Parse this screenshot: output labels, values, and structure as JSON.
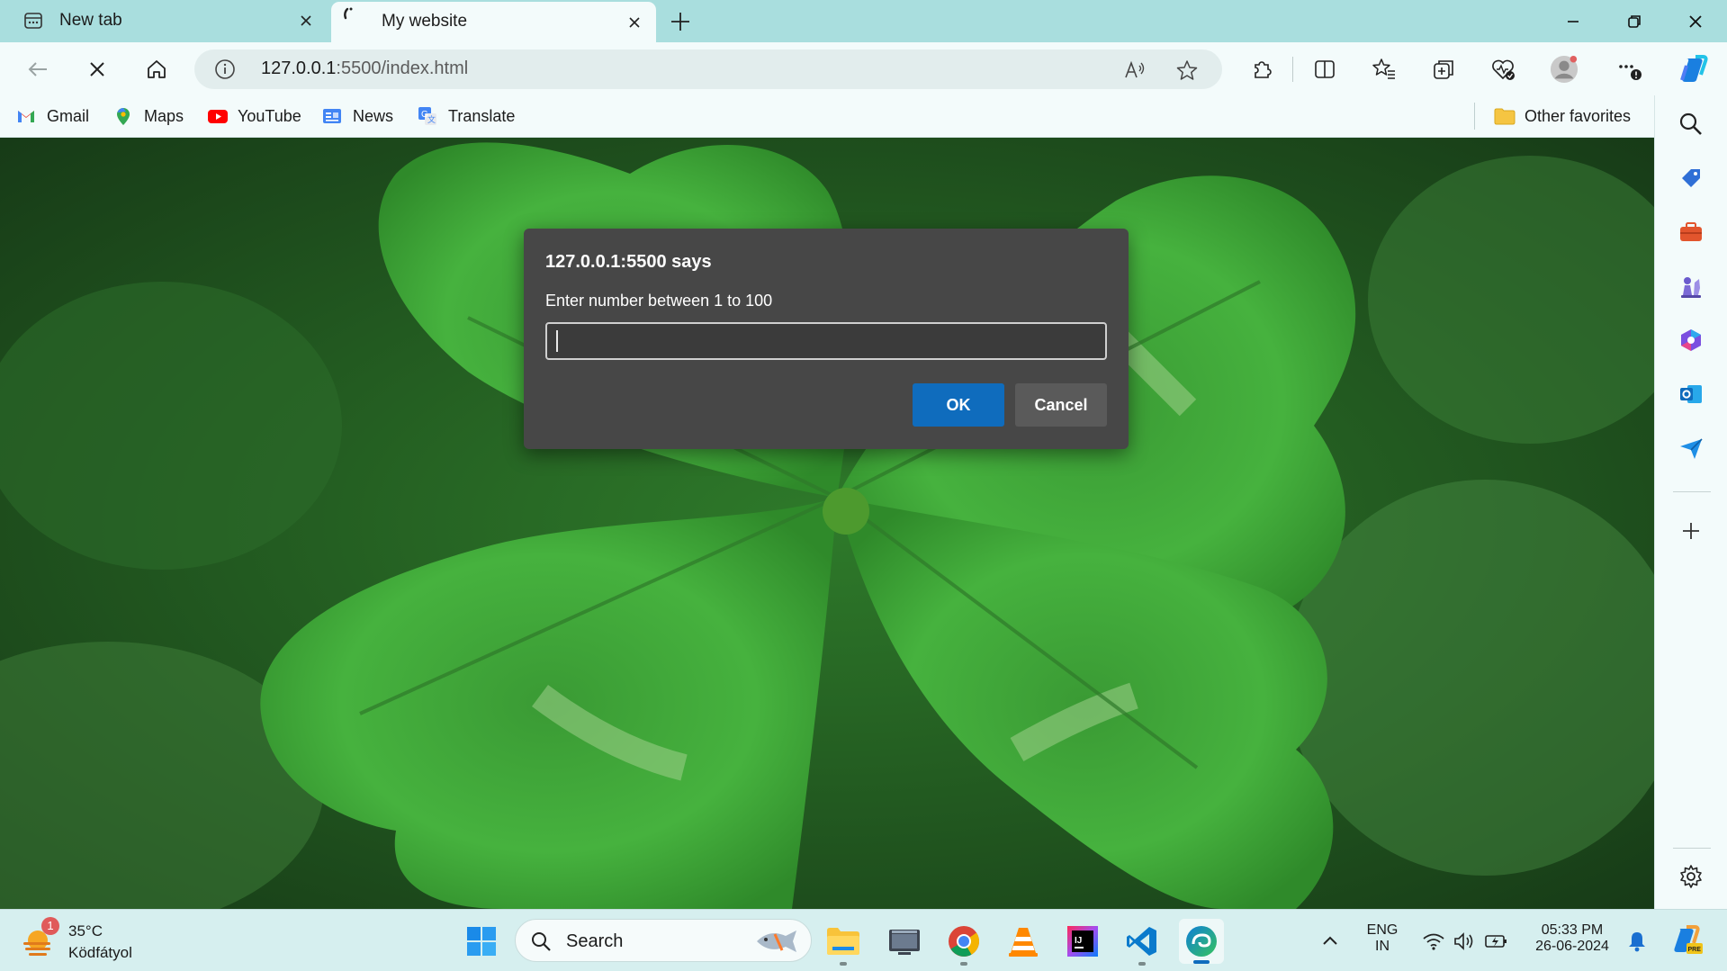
{
  "tabs": [
    {
      "title": "New tab",
      "icon": "new-tab-page-icon",
      "active": false
    },
    {
      "title": "My website",
      "icon": "loading-spinner-icon",
      "active": true
    }
  ],
  "toolbar": {
    "url_host": "127.0.0.1",
    "url_path": ":5500/index.html"
  },
  "favorites": [
    {
      "label": "Gmail",
      "icon": "gmail-icon"
    },
    {
      "label": "Maps",
      "icon": "maps-icon"
    },
    {
      "label": "YouTube",
      "icon": "youtube-icon"
    },
    {
      "label": "News",
      "icon": "news-icon"
    },
    {
      "label": "Translate",
      "icon": "translate-icon"
    }
  ],
  "other_favorites": "Other favorites",
  "dialog": {
    "title": "127.0.0.1:5500 says",
    "message": "Enter number between 1 to 100",
    "input_value": "",
    "ok_label": "OK",
    "cancel_label": "Cancel"
  },
  "taskbar": {
    "weather_badge": "1",
    "temperature": "35°C",
    "condition": "Ködfátyol",
    "search_label": "Search",
    "lang_top": "ENG",
    "lang_bottom": "IN",
    "time": "05:33 PM",
    "date": "26-06-2024"
  },
  "colors": {
    "tab_strip": "#a9dede",
    "toolbar": "#f3fbfb",
    "dialog_bg": "#474747",
    "accent": "#0f6cbd",
    "taskbar": "#d6efef"
  }
}
